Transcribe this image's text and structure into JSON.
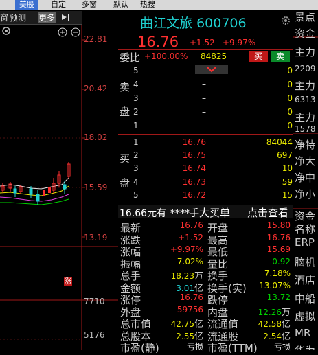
{
  "top_tabs": [
    "美股",
    "自定",
    "多窗",
    "默认",
    "热搜"
  ],
  "toolbar": {
    "items": [
      "窗",
      "预测",
      "更多"
    ],
    "icons": [
      "arrow-right-bar-icon",
      "plus-circle-icon",
      "minus-circle-icon",
      "gear-icon"
    ]
  },
  "chart": {
    "price_ticks": [
      "22.81",
      "20.42",
      "18.02",
      "15.59",
      "13.19"
    ],
    "volume_ticks": [
      "7710",
      "5176"
    ],
    "marker": "涨"
  },
  "stock": {
    "name": "曲江文旅",
    "code": "600706",
    "price": "16.76",
    "change": "+1.52",
    "change_pct": "+9.97%"
  },
  "weibi": {
    "label": "委比",
    "pct": "+100.00%",
    "value": "84825",
    "buy_btn": "买",
    "sell_btn": "卖"
  },
  "ask": {
    "label_1": "卖",
    "label_2": "盘",
    "levels": [
      {
        "lev": "5",
        "price": "–",
        "vol": "0"
      },
      {
        "lev": "4",
        "price": "–",
        "vol": "0"
      },
      {
        "lev": "3",
        "price": "–",
        "vol": "0"
      },
      {
        "lev": "2",
        "price": "–",
        "vol": "0"
      },
      {
        "lev": "1",
        "price": "–",
        "vol": "0"
      }
    ]
  },
  "bid": {
    "label_1": "买",
    "label_2": "盘",
    "levels": [
      {
        "lev": "1",
        "price": "16.76",
        "vol": "84044"
      },
      {
        "lev": "2",
        "price": "16.75",
        "vol": "697"
      },
      {
        "lev": "3",
        "price": "16.74",
        "vol": "10"
      },
      {
        "lev": "4",
        "price": "16.73",
        "vol": "59"
      },
      {
        "lev": "5",
        "price": "16.72",
        "vol": "15"
      }
    ]
  },
  "big_order": {
    "price": "16.66元有",
    "hands": "****手",
    "label": "大买单",
    "action": "点击查看"
  },
  "stats": [
    {
      "l": "最新",
      "v": "16.76",
      "vc": "red",
      "l2": "开盘",
      "v2": "15.80",
      "v2c": "red"
    },
    {
      "l": "涨跌",
      "v": "+1.52",
      "vc": "red",
      "l2": "最高",
      "v2": "16.76",
      "v2c": "red"
    },
    {
      "l": "涨幅",
      "v": "+9.97%",
      "vc": "red",
      "l2": "最低",
      "v2": "15.69",
      "v2c": "red"
    },
    {
      "l": "振幅",
      "v": "7.02%",
      "vc": "yellow",
      "l2": "量比",
      "v2": "0.92",
      "v2c": "green"
    },
    {
      "l": "总手",
      "v": "18.23",
      "vu": "万",
      "vc": "yellow",
      "l2": "换手",
      "v2": "7.18%",
      "v2c": "yellow"
    },
    {
      "l": "金额",
      "v": "3.01",
      "vu": "亿",
      "vc": "cyan",
      "l2": "换手(实)",
      "v2": "13.07%",
      "v2c": "yellow"
    },
    {
      "l": "涨停",
      "v": "16.76",
      "vc": "red",
      "l2": "跌停",
      "v2": "13.72",
      "v2c": "green"
    },
    {
      "l": "外盘",
      "v": "59756",
      "vc": "red",
      "l2": "内盘",
      "v2": "12.26",
      "v2u": "万",
      "v2c": "green"
    },
    {
      "l": "总市值",
      "v": "42.75",
      "vu": "亿",
      "vc": "yellow",
      "l2": "流通值",
      "v2": "42.58",
      "v2u": "亿",
      "v2c": "yellow"
    },
    {
      "l": "总股本",
      "v": "2.55",
      "vu": "亿",
      "vc": "yellow",
      "l2": "流通股",
      "v2": "2.54",
      "v2u": "亿",
      "v2c": "yellow"
    },
    {
      "l": "市盈(静)",
      "v": "亏损",
      "vc": "white",
      "l2": "市盈(TTM)",
      "v2": "亏损",
      "v2c": "white"
    }
  ],
  "right_panel": {
    "items": [
      {
        "text": "景点",
        "cls": "white"
      },
      {
        "text": "资金",
        "cls": "white"
      },
      {
        "text": "主力",
        "cls": "white"
      },
      {
        "text": "2209",
        "cls": "red"
      },
      {
        "text": "主力",
        "cls": "white"
      },
      {
        "text": "6313",
        "cls": "green"
      },
      {
        "text": "主力",
        "cls": "white"
      },
      {
        "text": "1578",
        "cls": "red"
      },
      {
        "text": "净特",
        "cls": "white"
      },
      {
        "text": "净大",
        "cls": "white"
      },
      {
        "text": "净中",
        "cls": "white"
      },
      {
        "text": "净小",
        "cls": "white"
      },
      {
        "text": "资金",
        "cls": "white"
      },
      {
        "text": "名称",
        "cls": "white"
      },
      {
        "text": "ERP",
        "cls": "yellow"
      },
      {
        "text": "脑机",
        "cls": "yellow"
      },
      {
        "text": "酒店",
        "cls": "yellow"
      },
      {
        "text": "中船",
        "cls": "yellow"
      },
      {
        "text": "虚拟",
        "cls": "yellow"
      },
      {
        "text": "MR",
        "cls": "yellow"
      },
      {
        "text": "华为",
        "cls": "yellow"
      }
    ]
  },
  "colors": {
    "up": "#ff3030",
    "down": "#00d000",
    "accent": "#1fd0d0",
    "vol": "#e8e800"
  }
}
